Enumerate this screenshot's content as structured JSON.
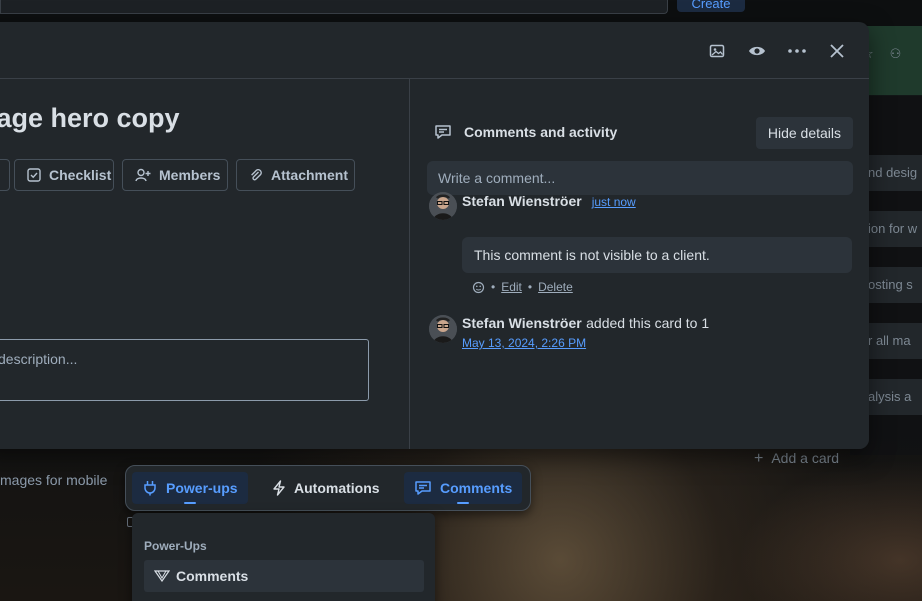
{
  "header": {
    "create_label": "Create"
  },
  "card": {
    "title": "page hero copy",
    "actions": {
      "checklist": "Checklist",
      "members": "Members",
      "attachment": "Attachment"
    },
    "description_placeholder": "description..."
  },
  "activity": {
    "heading": "Comments and activity",
    "hide_details": "Hide details",
    "comment_placeholder": "Write a comment...",
    "comment": {
      "author": "Stefan Wienströer",
      "time": "just now",
      "text": "This comment is not visible to a client.",
      "separator": "•",
      "edit": "Edit",
      "delete": "Delete"
    },
    "entry": {
      "author": "Stefan Wienströer",
      "text": "added this card to 1",
      "time": "May 13, 2024, 2:26 PM"
    }
  },
  "board": {
    "cards": [
      "nd desig",
      "ion for w",
      "osting s",
      "r all ma",
      "alysis a"
    ],
    "add_card": "Add a card",
    "bg_card_text": "mages for mobile"
  },
  "toolbar": {
    "powerups": "Power-ups",
    "automations": "Automations",
    "comments": "Comments"
  },
  "popup": {
    "title": "Power-Ups",
    "item": "Comments"
  },
  "colors": {
    "accent": "#579dff",
    "modal_bg": "#22272b",
    "text": "#d9dfe5"
  }
}
